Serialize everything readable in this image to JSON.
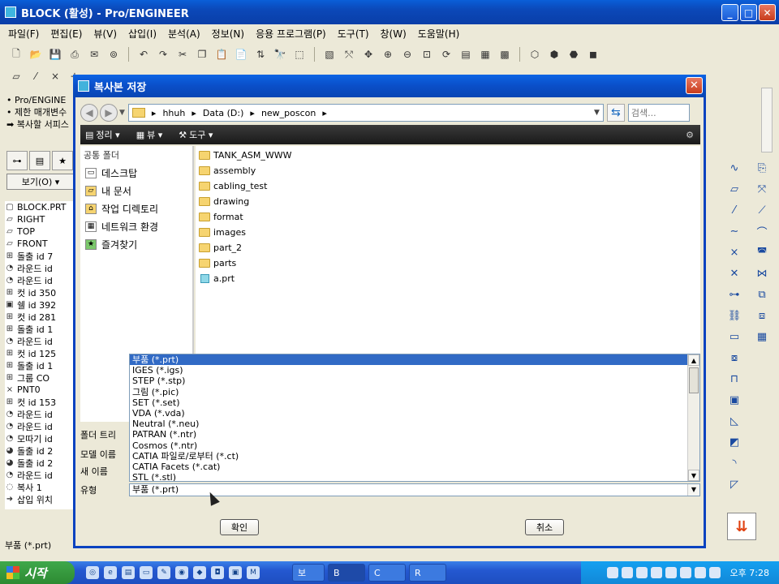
{
  "window": {
    "title": "BLOCK (활성) - Pro/ENGINEER"
  },
  "menu": [
    "파일(F)",
    "편집(E)",
    "뷰(V)",
    "삽입(I)",
    "분석(A)",
    "정보(N)",
    "응용 프로그램(P)",
    "도구(T)",
    "창(W)",
    "도움말(H)"
  ],
  "left": {
    "messages": [
      "• Pro/ENGINE",
      "• 제한 매개변수",
      "➡ 복사할 서피스"
    ],
    "view_button": "보기(O) ▾",
    "tree": [
      {
        "icon": "▢",
        "label": "BLOCK.PRT"
      },
      {
        "icon": "▱",
        "label": "RIGHT"
      },
      {
        "icon": "▱",
        "label": "TOP"
      },
      {
        "icon": "▱",
        "label": "FRONT"
      },
      {
        "icon": "⊞",
        "label": "돌출 id 7"
      },
      {
        "icon": "◔",
        "label": "라운드 id"
      },
      {
        "icon": "◔",
        "label": "라운드 id"
      },
      {
        "icon": "⊞",
        "label": "컷 id 350"
      },
      {
        "icon": "▣",
        "label": "쉘 id 392"
      },
      {
        "icon": "⊞",
        "label": "컷 id 281"
      },
      {
        "icon": "⊞",
        "label": "돌출 id 1"
      },
      {
        "icon": "◔",
        "label": "라운드 id"
      },
      {
        "icon": "⊞",
        "label": "컷 id 125"
      },
      {
        "icon": "⊞",
        "label": "돌출 id 1"
      },
      {
        "icon": "⊞",
        "label": "그룹 CO"
      },
      {
        "icon": "×",
        "label": "PNT0"
      },
      {
        "icon": "⊞",
        "label": "컷 id 153"
      },
      {
        "icon": "◔",
        "label": "라운드 id"
      },
      {
        "icon": "◔",
        "label": "라운드 id"
      },
      {
        "icon": "◔",
        "label": "모따기 id"
      },
      {
        "icon": "◕",
        "label": "돌출 id 2"
      },
      {
        "icon": "◕",
        "label": "돌출 id 2"
      },
      {
        "icon": "◔",
        "label": "라운드 id"
      },
      {
        "icon": "◌",
        "label": "복사 1"
      },
      {
        "icon": "➜",
        "label": "삽입 위치"
      }
    ],
    "status": "부품 (*.prt)"
  },
  "dialog": {
    "title": "복사본 저장",
    "path": [
      "hhuh",
      "Data (D:)",
      "new_poscon"
    ],
    "search_placeholder": "검색...",
    "toolbar": {
      "organize": "정리",
      "view": "뷰",
      "tools": "도구"
    },
    "favorites_header": "공통 폴더",
    "favorites": [
      "데스크탑",
      "내 문서",
      "작업 디렉토리",
      "네트워크 환경",
      "즐겨찾기"
    ],
    "files": [
      {
        "type": "folder",
        "name": "TANK_ASM_WWW"
      },
      {
        "type": "folder",
        "name": "assembly"
      },
      {
        "type": "folder",
        "name": "cabling_test"
      },
      {
        "type": "folder",
        "name": "drawing"
      },
      {
        "type": "folder",
        "name": "format"
      },
      {
        "type": "folder",
        "name": "images"
      },
      {
        "type": "folder",
        "name": "part_2"
      },
      {
        "type": "folder",
        "name": "parts"
      },
      {
        "type": "part",
        "name": "a.prt"
      }
    ],
    "labels": {
      "folder_tree": "폴더 트리",
      "model_name": "모델 이름",
      "new_name": "새 이름",
      "type": "유형"
    },
    "type_options": [
      "부품 (*.prt)",
      "IGES (*.igs)",
      "STEP (*.stp)",
      "그림 (*.pic)",
      "SET (*.set)",
      "VDA (*.vda)",
      "Neutral (*.neu)",
      "PATRAN (*.ntr)",
      "Cosmos (*.ntr)",
      "CATIA 파일로/로부터 (*.ct)",
      "CATIA Facets (*.cat)",
      "STL (*.stl)"
    ],
    "type_selected": "부품 (*.prt)",
    "ok": "확인",
    "cancel": "취소"
  },
  "taskbar": {
    "start": "시작",
    "tasks": [
      "보",
      "B",
      "C",
      "R"
    ],
    "clock": "오후 7:28"
  }
}
